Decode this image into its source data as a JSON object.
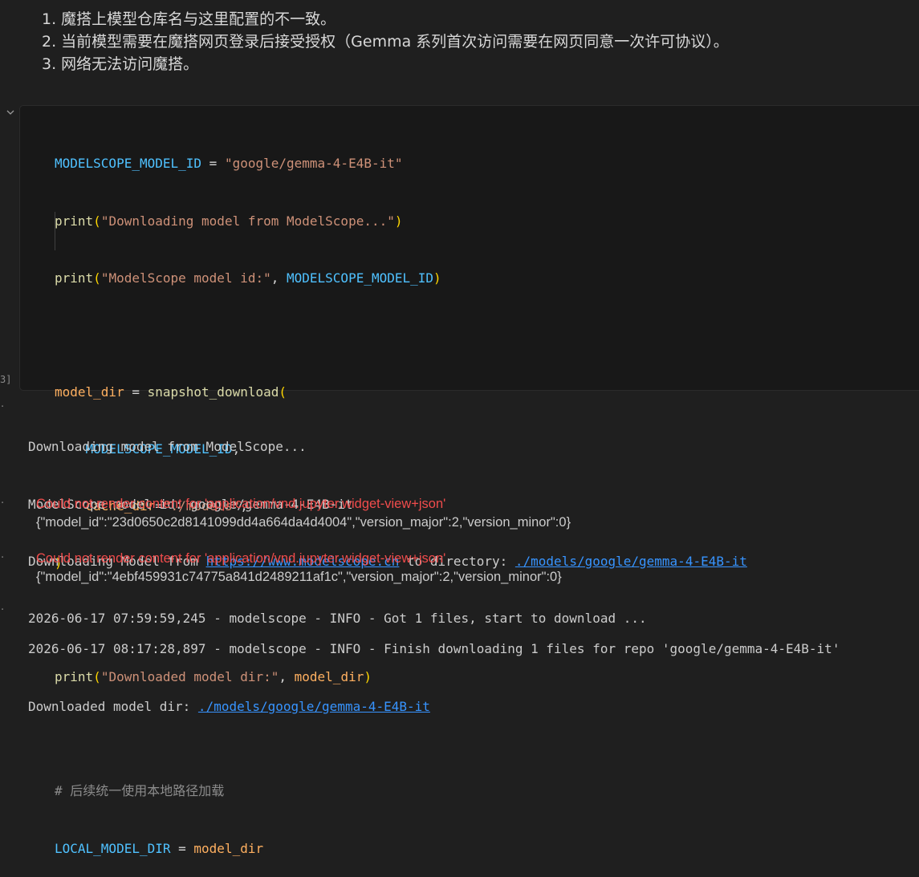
{
  "markdown": {
    "lines": [
      "1. 魔搭上模型仓库名与这里配置的不一致。",
      "2. 当前模型需要在魔搭网页登录后接受授权（Gemma 系列首次访问需要在网页同意一次许可协议）。",
      "3. 网络无法访问魔搭。"
    ]
  },
  "cell": {
    "exec_count": "3]",
    "code": {
      "l1_var": "MODELSCOPE_MODEL_ID",
      "l1_eq": " = ",
      "l1_str": "\"google/gemma-4-E4B-it\"",
      "l2_fn": "print",
      "l2_open": "(",
      "l2_str": "\"Downloading model from ModelScope...\"",
      "l2_close": ")",
      "l3_fn": "print",
      "l3_open": "(",
      "l3_str": "\"ModelScope model id:\"",
      "l3_comma": ", ",
      "l3_var": "MODELSCOPE_MODEL_ID",
      "l3_close": ")",
      "l5_var": "model_dir",
      "l5_eq": " = ",
      "l5_fn": "snapshot_download",
      "l5_open": "(",
      "l6_var": "MODELSCOPE_MODEL_ID",
      "l6_comma": ",",
      "l7_kw": "cache_dir",
      "l7_eq": "=",
      "l7_str": "\"./models\"",
      "l7_comma": ",",
      "l8_close": ")",
      "l10_fn": "print",
      "l10_open": "(",
      "l10_str": "\"Downloaded model dir:\"",
      "l10_comma": ", ",
      "l10_var": "model_dir",
      "l10_close": ")",
      "l12_comment": "# 后续统一使用本地路径加载",
      "l13_var": "LOCAL_MODEL_DIR",
      "l13_eq": " = ",
      "l13_val": "model_dir"
    }
  },
  "output": {
    "line1": "Downloading model from ModelScope...",
    "line2": "ModelScope model id: google/gemma-4-E4B-it",
    "line3_pre": "Downloading Model from ",
    "line3_link": "https://www.modelscope.cn",
    "line3_mid": " to directory: ",
    "line3_link2": "./models/google/gemma-4-E4B-it",
    "line4": "2026-06-17 07:59:59,245 - modelscope - INFO - Got 1 files, start to download ...",
    "err1": "Could not render content for 'application/vnd.jupyter.widget-view+json'",
    "json1": "{\"model_id\":\"23d0650c2d8141099dd4a664da4d4004\",\"version_major\":2,\"version_minor\":0}",
    "err2": "Could not render content for 'application/vnd.jupyter.widget-view+json'",
    "json2": "{\"model_id\":\"4ebf459931c74775a841d2489211af1c\",\"version_major\":2,\"version_minor\":0}",
    "line5": "2026-06-17 08:17:28,897 - modelscope - INFO - Finish downloading 1 files for repo 'google/gemma-4-E4B-it'",
    "line6_pre": "Downloaded model dir: ",
    "line6_link": "./models/google/gemma-4-E4B-it"
  }
}
